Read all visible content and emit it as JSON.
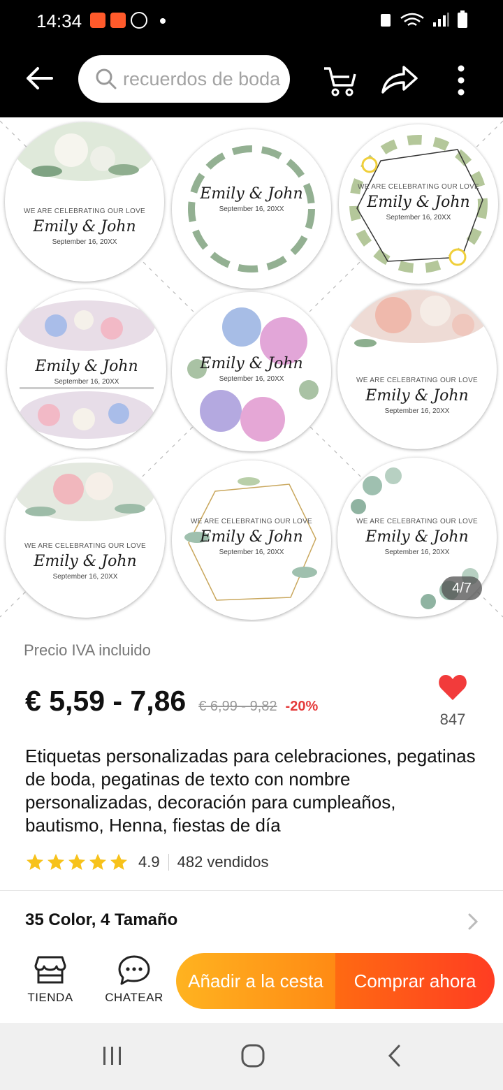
{
  "status_bar": {
    "time": "14:34"
  },
  "topbar": {
    "search_text": "recuerdos de boda"
  },
  "gallery": {
    "counter": "4/7",
    "stickers": [
      {
        "kicker": "WE ARE CELEBRATING OUR LOVE",
        "names": "Emily & John",
        "date": "September 16, 20XX"
      },
      {
        "kicker": "",
        "names": "Emily & John",
        "date": "September 16, 20XX"
      },
      {
        "kicker": "WE ARE CELEBRATING OUR LOVE",
        "names": "Emily & John",
        "date": "September 16, 20XX"
      },
      {
        "kicker": "",
        "names": "Emily & John",
        "date": "September 16, 20XX"
      },
      {
        "kicker": "",
        "names": "Emily & John",
        "date": "September 16, 20XX"
      },
      {
        "kicker": "WE ARE CELEBRATING OUR LOVE",
        "names": "Emily & John",
        "date": "September 16, 20XX"
      },
      {
        "kicker": "WE ARE CELEBRATING OUR LOVE",
        "names": "Emily & John",
        "date": "September 16, 20XX"
      },
      {
        "kicker": "WE ARE CELEBRATING OUR LOVE",
        "names": "Emily & John",
        "date": "September 16, 20XX"
      },
      {
        "kicker": "WE ARE CELEBRATING OUR LOVE",
        "names": "Emily & John",
        "date": "September 16, 20XX"
      }
    ]
  },
  "product": {
    "vat_note": "Precio IVA incluido",
    "price": "€ 5,59 - 7,86",
    "old_price": "€ 6,99 - 9,82",
    "discount": "-20%",
    "favorites": "847",
    "title": "Etiquetas personalizadas para celebraciones, pegatinas de boda, pegatinas de texto con nombre personalizadas, decoración para cumpleaños, bautismo, Henna, fiestas de día",
    "rating": "4.9",
    "stars": 5,
    "sold": "482 vendidos",
    "variants": "35 Color, 4 Tamaño"
  },
  "actions": {
    "store_label": "TIENDA",
    "chat_label": "CHATEAR",
    "add_to_cart": "Añadir a la cesta",
    "buy_now": "Comprar ahora"
  },
  "colors": {
    "accent_red": "#e53b3b",
    "add_cart_gradient": [
      "#ffb320",
      "#ff8a14"
    ],
    "buy_now_gradient": [
      "#ff6a12",
      "#ff3d22"
    ],
    "star": "#f7c21b",
    "heart": "#f23b3b"
  },
  "icons": {
    "back": "arrow-left-icon",
    "search": "search-icon",
    "cart": "cart-icon",
    "share": "share-icon",
    "more": "more-vertical-icon",
    "favorite": "heart-icon",
    "store": "store-icon",
    "chat": "chat-icon"
  }
}
